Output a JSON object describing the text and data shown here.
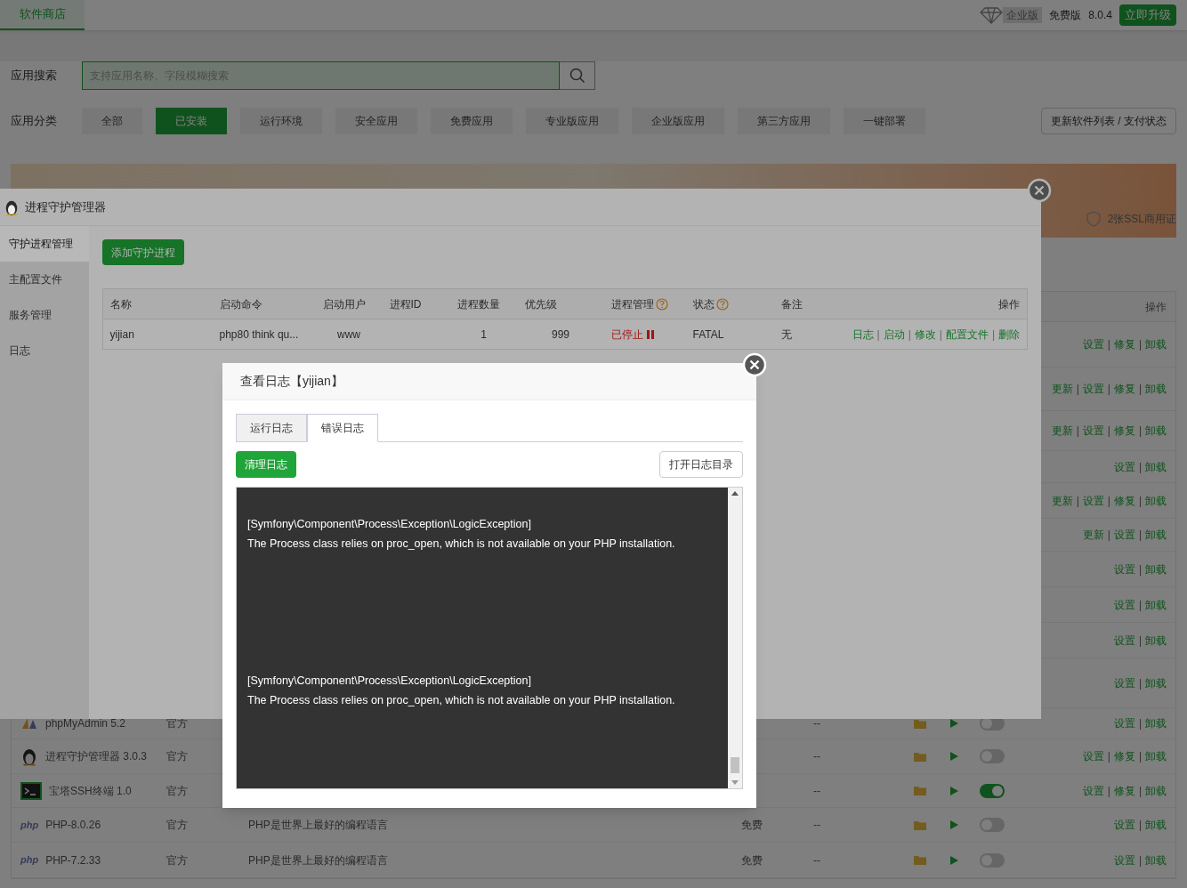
{
  "header": {
    "tab": {
      "label": "软件商店",
      "selected": true
    },
    "edition_badge": "企业版",
    "edition": "免费版",
    "version": "8.0.4",
    "upgrade_button": "立即升级"
  },
  "search": {
    "label": "应用搜索",
    "placeholder": "支持应用名称、字段模糊搜索"
  },
  "categories": {
    "label": "应用分类",
    "items": [
      {
        "label": "全部",
        "selected": false
      },
      {
        "label": "已安装",
        "selected": true
      },
      {
        "label": "运行环境",
        "selected": false
      },
      {
        "label": "安全应用",
        "selected": false
      },
      {
        "label": "免费应用",
        "selected": false
      },
      {
        "label": "专业版应用",
        "selected": false
      },
      {
        "label": "企业版应用",
        "selected": false
      },
      {
        "label": "第三方应用",
        "selected": false
      },
      {
        "label": "一键部署",
        "selected": false
      }
    ],
    "refresh_button": "更新软件列表 / 支付状态"
  },
  "banner": {
    "ssl_text": "2张SSL商用证"
  },
  "apps": {
    "action_separator": "|",
    "columns": {
      "actions": "操作"
    },
    "rows": [
      {
        "actions": [
          "设置",
          "修复",
          "卸载"
        ]
      },
      {
        "actions": [
          "更新",
          "设置",
          "修复",
          "卸载"
        ]
      },
      {
        "actions": [
          "更新",
          "设置",
          "修复",
          "卸载"
        ]
      },
      {
        "actions": [
          "设置",
          "卸载"
        ]
      },
      {
        "actions": [
          "更新",
          "设置",
          "修复",
          "卸载"
        ]
      },
      {
        "actions": [
          "更新",
          "设置",
          "卸载"
        ]
      },
      {
        "actions": [
          "设置",
          "卸载"
        ]
      },
      {
        "actions": [
          "设置",
          "卸载"
        ]
      },
      {
        "actions": [
          "设置",
          "卸载"
        ]
      },
      {
        "actions": [
          "设置",
          "卸载"
        ]
      },
      {
        "kind": "phpmyadmin",
        "name": "phpMyAdmin 5.2",
        "source": "官方",
        "expiry": "--",
        "enabled": false,
        "actions": [
          "设置",
          "卸载"
        ]
      },
      {
        "kind": "penguin",
        "name": "进程守护管理器 3.0.3",
        "source": "官方",
        "expiry": "--",
        "enabled": false,
        "actions": [
          "设置",
          "修复",
          "卸载"
        ]
      },
      {
        "kind": "terminal",
        "name": "宝塔SSH终端 1.0",
        "source": "官方",
        "expiry": "--",
        "enabled": true,
        "actions": [
          "设置",
          "修复",
          "卸载"
        ]
      },
      {
        "kind": "php",
        "logo_text": "php",
        "name": "PHP-8.0.26",
        "source": "官方",
        "description": "PHP是世界上最好的编程语言",
        "price": "免费",
        "expiry": "--",
        "enabled": false,
        "actions": [
          "设置",
          "卸载"
        ]
      },
      {
        "kind": "php",
        "logo_text": "php",
        "name": "PHP-7.2.33",
        "source": "官方",
        "description": "PHP是世界上最好的编程语言",
        "price": "免费",
        "expiry": "--",
        "enabled": false,
        "actions": [
          "设置",
          "卸载"
        ]
      }
    ]
  },
  "supervisor_dialog": {
    "title": "进程守护管理器",
    "sidebar": [
      {
        "label": "守护进程管理",
        "selected": true
      },
      {
        "label": "主配置文件",
        "selected": false
      },
      {
        "label": "服务管理",
        "selected": false
      },
      {
        "label": "日志",
        "selected": false
      }
    ],
    "add_button": "添加守护进程",
    "table": {
      "columns": [
        {
          "label": "名称"
        },
        {
          "label": "启动命令"
        },
        {
          "label": "启动用户"
        },
        {
          "label": "进程ID"
        },
        {
          "label": "进程数量"
        },
        {
          "label": "优先级"
        },
        {
          "label": "进程管理",
          "help": true
        },
        {
          "label": "状态",
          "help": true
        },
        {
          "label": "备注"
        },
        {
          "label": "操作"
        }
      ],
      "rows": [
        {
          "name": "yijian",
          "command": "php80 think qu...",
          "user": "www",
          "count": "1",
          "priority": "999",
          "management": "已停止",
          "stopped": true,
          "status": "FATAL",
          "note": "无",
          "actions": [
            "日志",
            "启动",
            "修改",
            "配置文件",
            "删除"
          ]
        }
      ]
    }
  },
  "log_dialog": {
    "title": "查看日志【yijian】",
    "tabs": [
      {
        "label": "运行日志",
        "selected": false
      },
      {
        "label": "错误日志",
        "selected": true
      }
    ],
    "clear_button": "清理日志",
    "open_dir_button": "打开日志目录",
    "log_entries": [
      {
        "lines": [
          "[Symfony\\Component\\Process\\Exception\\LogicException]",
          "The Process class relies on proc_open, which is not available on your PHP installation."
        ]
      },
      {
        "lines": [
          "[Symfony\\Component\\Process\\Exception\\LogicException]",
          "The Process class relies on proc_open, which is not available on your PHP installation."
        ]
      }
    ]
  }
}
